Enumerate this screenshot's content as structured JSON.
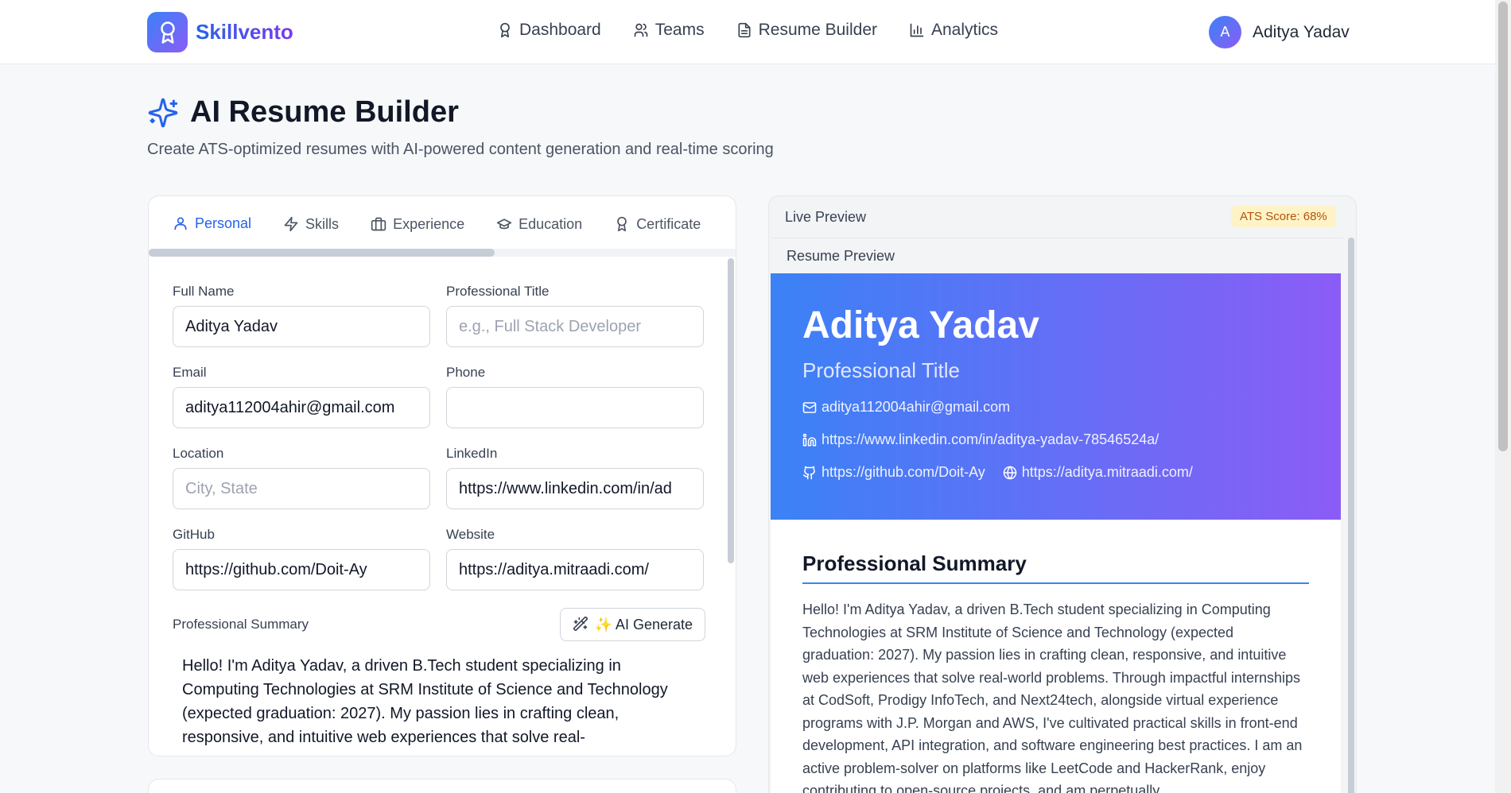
{
  "brand": {
    "name": "Skillvento"
  },
  "nav": {
    "links": [
      {
        "label": "Dashboard",
        "icon": "award-icon"
      },
      {
        "label": "Teams",
        "icon": "users-icon"
      },
      {
        "label": "Resume Builder",
        "icon": "file-text-icon"
      },
      {
        "label": "Analytics",
        "icon": "bar-chart-icon"
      }
    ]
  },
  "user": {
    "initial": "A",
    "name": "Aditya Yadav"
  },
  "header": {
    "title": "AI Resume Builder",
    "subtitle": "Create ATS-optimized resumes with AI-powered content generation and real-time scoring"
  },
  "tabs": [
    {
      "label": "Personal",
      "icon": "user-icon",
      "active": true
    },
    {
      "label": "Skills",
      "icon": "zap-icon"
    },
    {
      "label": "Experience",
      "icon": "briefcase-icon"
    },
    {
      "label": "Education",
      "icon": "graduation-cap-icon"
    },
    {
      "label": "Certificate",
      "icon": "award-icon"
    }
  ],
  "form": {
    "full_name": {
      "label": "Full Name",
      "value": "Aditya Yadav",
      "placeholder": ""
    },
    "professional_title": {
      "label": "Professional Title",
      "value": "",
      "placeholder": "e.g., Full Stack Developer"
    },
    "email": {
      "label": "Email",
      "value": "aditya112004ahir@gmail.com",
      "placeholder": ""
    },
    "phone": {
      "label": "Phone",
      "value": "",
      "placeholder": ""
    },
    "location": {
      "label": "Location",
      "value": "",
      "placeholder": "City, State"
    },
    "linkedin": {
      "label": "LinkedIn",
      "value": "https://www.linkedin.com/in/ad",
      "placeholder": ""
    },
    "github": {
      "label": "GitHub",
      "value": "https://github.com/Doit-Ay",
      "placeholder": ""
    },
    "website": {
      "label": "Website",
      "value": "https://aditya.mitraadi.com/",
      "placeholder": ""
    },
    "summary_label": "Professional Summary",
    "ai_generate_label": "✨ AI Generate",
    "summary_text": "Hello! I'm Aditya Yadav, a driven B.Tech student specializing in Computing Technologies at SRM Institute of Science and Technology (expected graduation: 2027). My passion lies in crafting clean, responsive, and intuitive web experiences that solve real-"
  },
  "preview": {
    "live_label": "Live Preview",
    "ats_score": "ATS Score: 68%",
    "resume_label": "Resume Preview",
    "name": "Aditya Yadav",
    "title": "Professional Title",
    "email": "aditya112004ahir@gmail.com",
    "linkedin": "https://www.linkedin.com/in/aditya-yadav-78546524a/",
    "github": "https://github.com/Doit-Ay",
    "website": "https://aditya.mitraadi.com/",
    "summary_heading": "Professional Summary",
    "summary_text": "Hello! I'm Aditya Yadav, a driven B.Tech student specializing in Computing Technologies at SRM Institute of Science and Technology (expected graduation: 2027). My passion lies in crafting clean, responsive, and intuitive web experiences that solve real-world problems. Through impactful internships at CodSoft, Prodigy InfoTech, and Next24tech, alongside virtual experience programs with J.P. Morgan and AWS, I've cultivated practical skills in front-end development, API integration, and software engineering best practices. I am an active problem-solver on platforms like LeetCode and HackerRank, enjoy contributing to open-source projects, and am perpetually"
  },
  "colors": {
    "primary": "#2563eb",
    "gradient_start": "#3b82f6",
    "gradient_end": "#8b5cf6",
    "ats_bg": "#fef3c7",
    "ats_text": "#b45309"
  }
}
